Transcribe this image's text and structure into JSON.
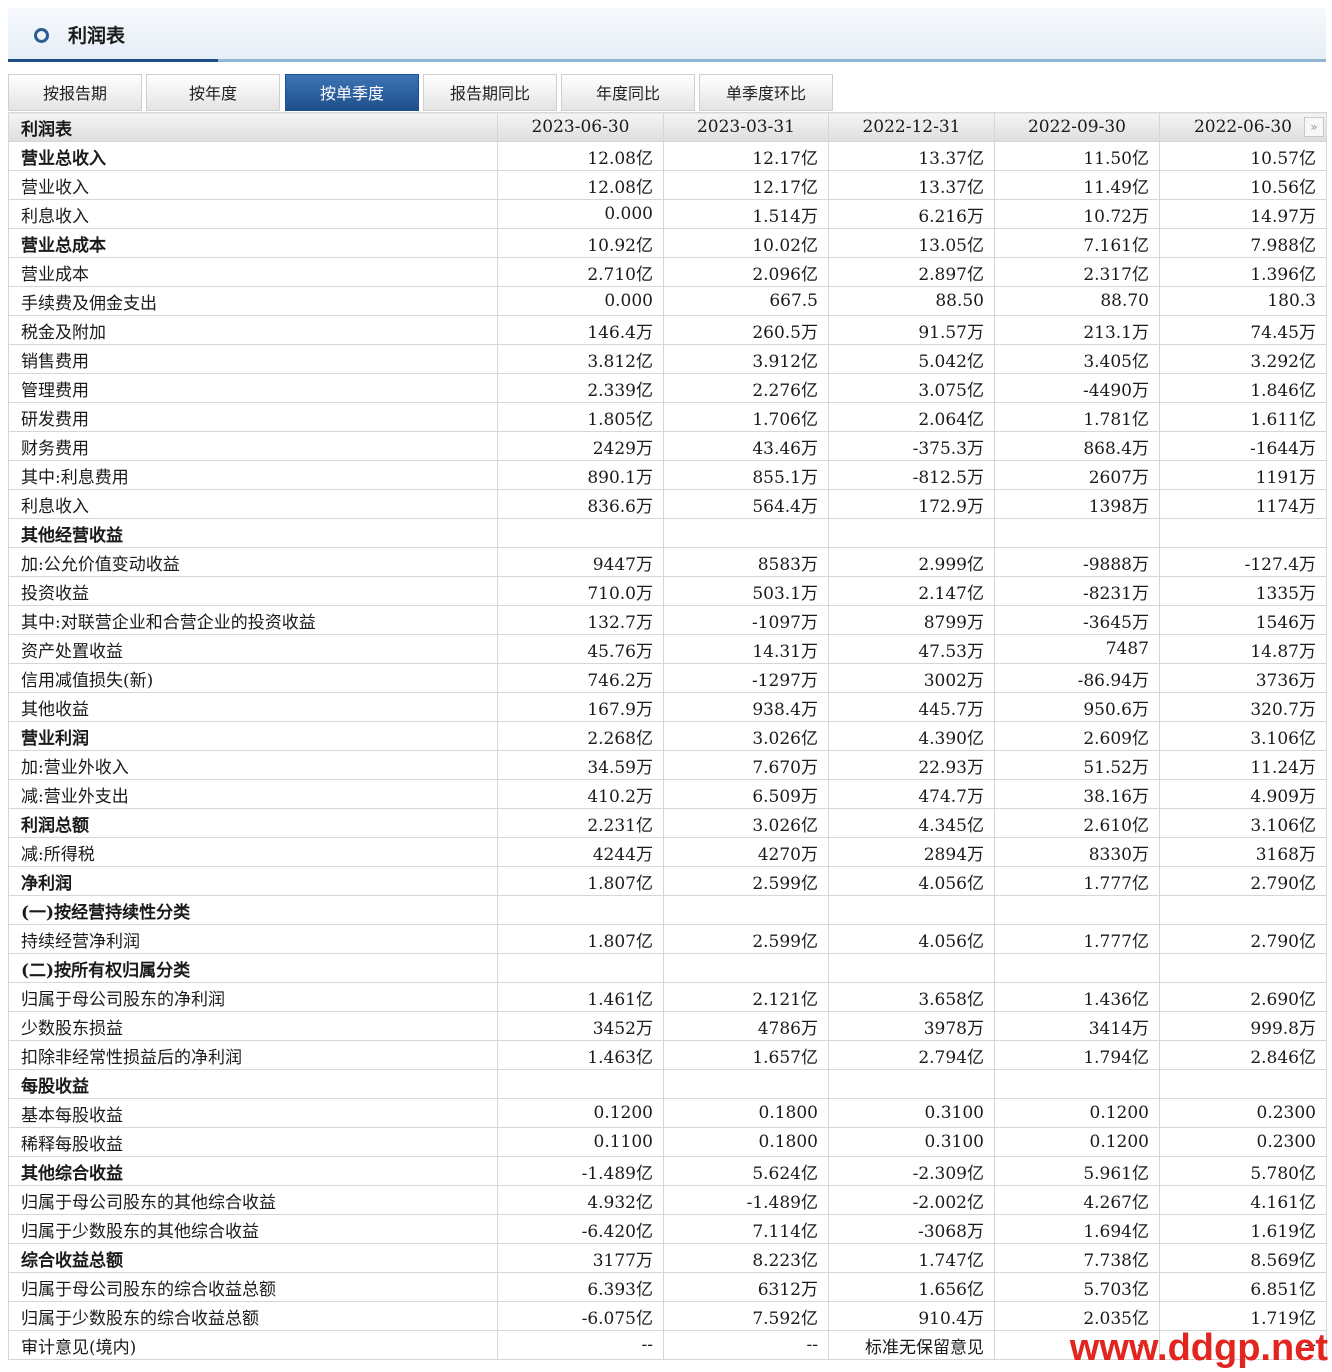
{
  "panel": {
    "title": "利润表"
  },
  "tabs": [
    {
      "label": "按报告期",
      "active": false
    },
    {
      "label": "按年度",
      "active": false
    },
    {
      "label": "按单季度",
      "active": true
    },
    {
      "label": "报告期同比",
      "active": false
    },
    {
      "label": "年度同比",
      "active": false
    },
    {
      "label": "单季度环比",
      "active": false
    }
  ],
  "table": {
    "corner_label": "利润表",
    "columns": [
      "2023-06-30",
      "2023-03-31",
      "2022-12-31",
      "2022-09-30",
      "2022-06-30"
    ],
    "next_icon": "»",
    "rows": [
      {
        "label": "营业总收入",
        "bold": true,
        "indent": 0,
        "values": [
          "12.08亿",
          "12.17亿",
          "13.37亿",
          "11.50亿",
          "10.57亿"
        ]
      },
      {
        "label": "营业收入",
        "bold": false,
        "indent": 1,
        "values": [
          "12.08亿",
          "12.17亿",
          "13.37亿",
          "11.49亿",
          "10.56亿"
        ]
      },
      {
        "label": "利息收入",
        "bold": false,
        "indent": 1,
        "values": [
          "0.000",
          "1.514万",
          "6.216万",
          "10.72万",
          "14.97万"
        ]
      },
      {
        "label": "营业总成本",
        "bold": true,
        "indent": 0,
        "values": [
          "10.92亿",
          "10.02亿",
          "13.05亿",
          "7.161亿",
          "7.988亿"
        ]
      },
      {
        "label": "营业成本",
        "bold": false,
        "indent": 1,
        "values": [
          "2.710亿",
          "2.096亿",
          "2.897亿",
          "2.317亿",
          "1.396亿"
        ]
      },
      {
        "label": "手续费及佣金支出",
        "bold": false,
        "indent": 1,
        "values": [
          "0.000",
          "667.5",
          "88.50",
          "88.70",
          "180.3"
        ]
      },
      {
        "label": "税金及附加",
        "bold": false,
        "indent": 1,
        "values": [
          "146.4万",
          "260.5万",
          "91.57万",
          "213.1万",
          "74.45万"
        ]
      },
      {
        "label": "销售费用",
        "bold": false,
        "indent": 1,
        "values": [
          "3.812亿",
          "3.912亿",
          "5.042亿",
          "3.405亿",
          "3.292亿"
        ]
      },
      {
        "label": "管理费用",
        "bold": false,
        "indent": 1,
        "values": [
          "2.339亿",
          "2.276亿",
          "3.075亿",
          "-4490万",
          "1.846亿"
        ]
      },
      {
        "label": "研发费用",
        "bold": false,
        "indent": 1,
        "values": [
          "1.805亿",
          "1.706亿",
          "2.064亿",
          "1.781亿",
          "1.611亿"
        ]
      },
      {
        "label": "财务费用",
        "bold": false,
        "indent": 1,
        "values": [
          "2429万",
          "43.46万",
          "-375.3万",
          "868.4万",
          "-1644万"
        ]
      },
      {
        "label": "其中:利息费用",
        "bold": false,
        "indent": 1,
        "values": [
          "890.1万",
          "855.1万",
          "-812.5万",
          "2607万",
          "1191万"
        ]
      },
      {
        "label": "利息收入",
        "bold": false,
        "indent": 3,
        "values": [
          "836.6万",
          "564.4万",
          "172.9万",
          "1398万",
          "1174万"
        ]
      },
      {
        "label": "其他经营收益",
        "bold": true,
        "indent": 0,
        "values": [
          "",
          "",
          "",
          "",
          ""
        ]
      },
      {
        "label": "加:公允价值变动收益",
        "bold": false,
        "indent": 1,
        "values": [
          "9447万",
          "8583万",
          "2.999亿",
          "-9888万",
          "-127.4万"
        ]
      },
      {
        "label": "投资收益",
        "bold": false,
        "indent": 2,
        "values": [
          "710.0万",
          "503.1万",
          "2.147亿",
          "-8231万",
          "1335万"
        ]
      },
      {
        "label": "其中:对联营企业和合营企业的投资收益",
        "bold": false,
        "indent": 1,
        "values": [
          "132.7万",
          "-1097万",
          "8799万",
          "-3645万",
          "1546万"
        ]
      },
      {
        "label": "资产处置收益",
        "bold": false,
        "indent": 1,
        "values": [
          "45.76万",
          "14.31万",
          "47.53万",
          "7487",
          "14.87万"
        ]
      },
      {
        "label": "信用减值损失(新)",
        "bold": false,
        "indent": 1,
        "values": [
          "746.2万",
          "-1297万",
          "3002万",
          "-86.94万",
          "3736万"
        ]
      },
      {
        "label": "其他收益",
        "bold": false,
        "indent": 1,
        "values": [
          "167.9万",
          "938.4万",
          "445.7万",
          "950.6万",
          "320.7万"
        ]
      },
      {
        "label": "营业利润",
        "bold": true,
        "indent": 0,
        "values": [
          "2.268亿",
          "3.026亿",
          "4.390亿",
          "2.609亿",
          "3.106亿"
        ]
      },
      {
        "label": "加:营业外收入",
        "bold": false,
        "indent": 1,
        "values": [
          "34.59万",
          "7.670万",
          "22.93万",
          "51.52万",
          "11.24万"
        ]
      },
      {
        "label": "减:营业外支出",
        "bold": false,
        "indent": 1,
        "values": [
          "410.2万",
          "6.509万",
          "474.7万",
          "38.16万",
          "4.909万"
        ]
      },
      {
        "label": "利润总额",
        "bold": true,
        "indent": 0,
        "values": [
          "2.231亿",
          "3.026亿",
          "4.345亿",
          "2.610亿",
          "3.106亿"
        ]
      },
      {
        "label": "减:所得税",
        "bold": false,
        "indent": 1,
        "values": [
          "4244万",
          "4270万",
          "2894万",
          "8330万",
          "3168万"
        ]
      },
      {
        "label": "净利润",
        "bold": true,
        "indent": 0,
        "values": [
          "1.807亿",
          "2.599亿",
          "4.056亿",
          "1.777亿",
          "2.790亿"
        ]
      },
      {
        "label": "(一)按经营持续性分类",
        "bold": true,
        "indent": 0,
        "values": [
          "",
          "",
          "",
          "",
          ""
        ]
      },
      {
        "label": "持续经营净利润",
        "bold": false,
        "indent": 1,
        "values": [
          "1.807亿",
          "2.599亿",
          "4.056亿",
          "1.777亿",
          "2.790亿"
        ]
      },
      {
        "label": "(二)按所有权归属分类",
        "bold": true,
        "indent": 0,
        "values": [
          "",
          "",
          "",
          "",
          ""
        ]
      },
      {
        "label": "归属于母公司股东的净利润",
        "bold": false,
        "indent": 1,
        "values": [
          "1.461亿",
          "2.121亿",
          "3.658亿",
          "1.436亿",
          "2.690亿"
        ]
      },
      {
        "label": "少数股东损益",
        "bold": false,
        "indent": 1,
        "values": [
          "3452万",
          "4786万",
          "3978万",
          "3414万",
          "999.8万"
        ]
      },
      {
        "label": "扣除非经常性损益后的净利润",
        "bold": false,
        "indent": 1,
        "values": [
          "1.463亿",
          "1.657亿",
          "2.794亿",
          "1.794亿",
          "2.846亿"
        ]
      },
      {
        "label": "每股收益",
        "bold": true,
        "indent": 0,
        "values": [
          "",
          "",
          "",
          "",
          ""
        ]
      },
      {
        "label": "基本每股收益",
        "bold": false,
        "indent": 1,
        "values": [
          "0.1200",
          "0.1800",
          "0.3100",
          "0.1200",
          "0.2300"
        ]
      },
      {
        "label": "稀释每股收益",
        "bold": false,
        "indent": 1,
        "values": [
          "0.1100",
          "0.1800",
          "0.3100",
          "0.1200",
          "0.2300"
        ]
      },
      {
        "label": "其他综合收益",
        "bold": true,
        "indent": 0,
        "values": [
          "-1.489亿",
          "5.624亿",
          "-2.309亿",
          "5.961亿",
          "5.780亿"
        ]
      },
      {
        "label": "归属于母公司股东的其他综合收益",
        "bold": false,
        "indent": 1,
        "values": [
          "4.932亿",
          "-1.489亿",
          "-2.002亿",
          "4.267亿",
          "4.161亿"
        ]
      },
      {
        "label": "归属于少数股东的其他综合收益",
        "bold": false,
        "indent": 1,
        "values": [
          "-6.420亿",
          "7.114亿",
          "-3068万",
          "1.694亿",
          "1.619亿"
        ]
      },
      {
        "label": "综合收益总额",
        "bold": true,
        "indent": 0,
        "values": [
          "3177万",
          "8.223亿",
          "1.747亿",
          "7.738亿",
          "8.569亿"
        ]
      },
      {
        "label": "归属于母公司股东的综合收益总额",
        "bold": false,
        "indent": 1,
        "values": [
          "6.393亿",
          "6312万",
          "1.656亿",
          "5.703亿",
          "6.851亿"
        ]
      },
      {
        "label": "归属于少数股东的综合收益总额",
        "bold": false,
        "indent": 1,
        "values": [
          "-6.075亿",
          "7.592亿",
          "910.4万",
          "2.035亿",
          "1.719亿"
        ]
      },
      {
        "label": "审计意见(境内)",
        "bold": false,
        "indent": 1,
        "values": [
          "--",
          "--",
          "标准无保留意见",
          "--",
          "--"
        ]
      }
    ]
  },
  "watermark": "www.ddgp.net",
  "colors": {
    "accent": "#1f4f8c",
    "watermark": "#e2251f"
  }
}
